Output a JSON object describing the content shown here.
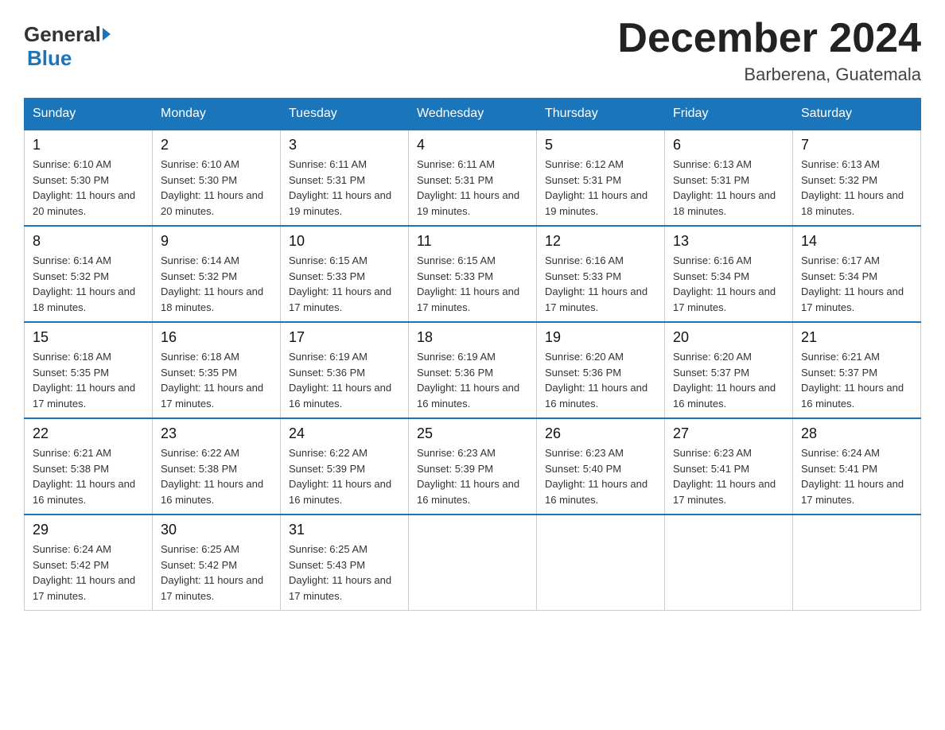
{
  "header": {
    "logo_general": "General",
    "logo_blue": "Blue",
    "month_title": "December 2024",
    "location": "Barberena, Guatemala"
  },
  "days_of_week": [
    "Sunday",
    "Monday",
    "Tuesday",
    "Wednesday",
    "Thursday",
    "Friday",
    "Saturday"
  ],
  "weeks": [
    [
      {
        "day": "1",
        "sunrise": "6:10 AM",
        "sunset": "5:30 PM",
        "daylight": "11 hours and 20 minutes."
      },
      {
        "day": "2",
        "sunrise": "6:10 AM",
        "sunset": "5:30 PM",
        "daylight": "11 hours and 20 minutes."
      },
      {
        "day": "3",
        "sunrise": "6:11 AM",
        "sunset": "5:31 PM",
        "daylight": "11 hours and 19 minutes."
      },
      {
        "day": "4",
        "sunrise": "6:11 AM",
        "sunset": "5:31 PM",
        "daylight": "11 hours and 19 minutes."
      },
      {
        "day": "5",
        "sunrise": "6:12 AM",
        "sunset": "5:31 PM",
        "daylight": "11 hours and 19 minutes."
      },
      {
        "day": "6",
        "sunrise": "6:13 AM",
        "sunset": "5:31 PM",
        "daylight": "11 hours and 18 minutes."
      },
      {
        "day": "7",
        "sunrise": "6:13 AM",
        "sunset": "5:32 PM",
        "daylight": "11 hours and 18 minutes."
      }
    ],
    [
      {
        "day": "8",
        "sunrise": "6:14 AM",
        "sunset": "5:32 PM",
        "daylight": "11 hours and 18 minutes."
      },
      {
        "day": "9",
        "sunrise": "6:14 AM",
        "sunset": "5:32 PM",
        "daylight": "11 hours and 18 minutes."
      },
      {
        "day": "10",
        "sunrise": "6:15 AM",
        "sunset": "5:33 PM",
        "daylight": "11 hours and 17 minutes."
      },
      {
        "day": "11",
        "sunrise": "6:15 AM",
        "sunset": "5:33 PM",
        "daylight": "11 hours and 17 minutes."
      },
      {
        "day": "12",
        "sunrise": "6:16 AM",
        "sunset": "5:33 PM",
        "daylight": "11 hours and 17 minutes."
      },
      {
        "day": "13",
        "sunrise": "6:16 AM",
        "sunset": "5:34 PM",
        "daylight": "11 hours and 17 minutes."
      },
      {
        "day": "14",
        "sunrise": "6:17 AM",
        "sunset": "5:34 PM",
        "daylight": "11 hours and 17 minutes."
      }
    ],
    [
      {
        "day": "15",
        "sunrise": "6:18 AM",
        "sunset": "5:35 PM",
        "daylight": "11 hours and 17 minutes."
      },
      {
        "day": "16",
        "sunrise": "6:18 AM",
        "sunset": "5:35 PM",
        "daylight": "11 hours and 17 minutes."
      },
      {
        "day": "17",
        "sunrise": "6:19 AM",
        "sunset": "5:36 PM",
        "daylight": "11 hours and 16 minutes."
      },
      {
        "day": "18",
        "sunrise": "6:19 AM",
        "sunset": "5:36 PM",
        "daylight": "11 hours and 16 minutes."
      },
      {
        "day": "19",
        "sunrise": "6:20 AM",
        "sunset": "5:36 PM",
        "daylight": "11 hours and 16 minutes."
      },
      {
        "day": "20",
        "sunrise": "6:20 AM",
        "sunset": "5:37 PM",
        "daylight": "11 hours and 16 minutes."
      },
      {
        "day": "21",
        "sunrise": "6:21 AM",
        "sunset": "5:37 PM",
        "daylight": "11 hours and 16 minutes."
      }
    ],
    [
      {
        "day": "22",
        "sunrise": "6:21 AM",
        "sunset": "5:38 PM",
        "daylight": "11 hours and 16 minutes."
      },
      {
        "day": "23",
        "sunrise": "6:22 AM",
        "sunset": "5:38 PM",
        "daylight": "11 hours and 16 minutes."
      },
      {
        "day": "24",
        "sunrise": "6:22 AM",
        "sunset": "5:39 PM",
        "daylight": "11 hours and 16 minutes."
      },
      {
        "day": "25",
        "sunrise": "6:23 AM",
        "sunset": "5:39 PM",
        "daylight": "11 hours and 16 minutes."
      },
      {
        "day": "26",
        "sunrise": "6:23 AM",
        "sunset": "5:40 PM",
        "daylight": "11 hours and 16 minutes."
      },
      {
        "day": "27",
        "sunrise": "6:23 AM",
        "sunset": "5:41 PM",
        "daylight": "11 hours and 17 minutes."
      },
      {
        "day": "28",
        "sunrise": "6:24 AM",
        "sunset": "5:41 PM",
        "daylight": "11 hours and 17 minutes."
      }
    ],
    [
      {
        "day": "29",
        "sunrise": "6:24 AM",
        "sunset": "5:42 PM",
        "daylight": "11 hours and 17 minutes."
      },
      {
        "day": "30",
        "sunrise": "6:25 AM",
        "sunset": "5:42 PM",
        "daylight": "11 hours and 17 minutes."
      },
      {
        "day": "31",
        "sunrise": "6:25 AM",
        "sunset": "5:43 PM",
        "daylight": "11 hours and 17 minutes."
      },
      null,
      null,
      null,
      null
    ]
  ]
}
